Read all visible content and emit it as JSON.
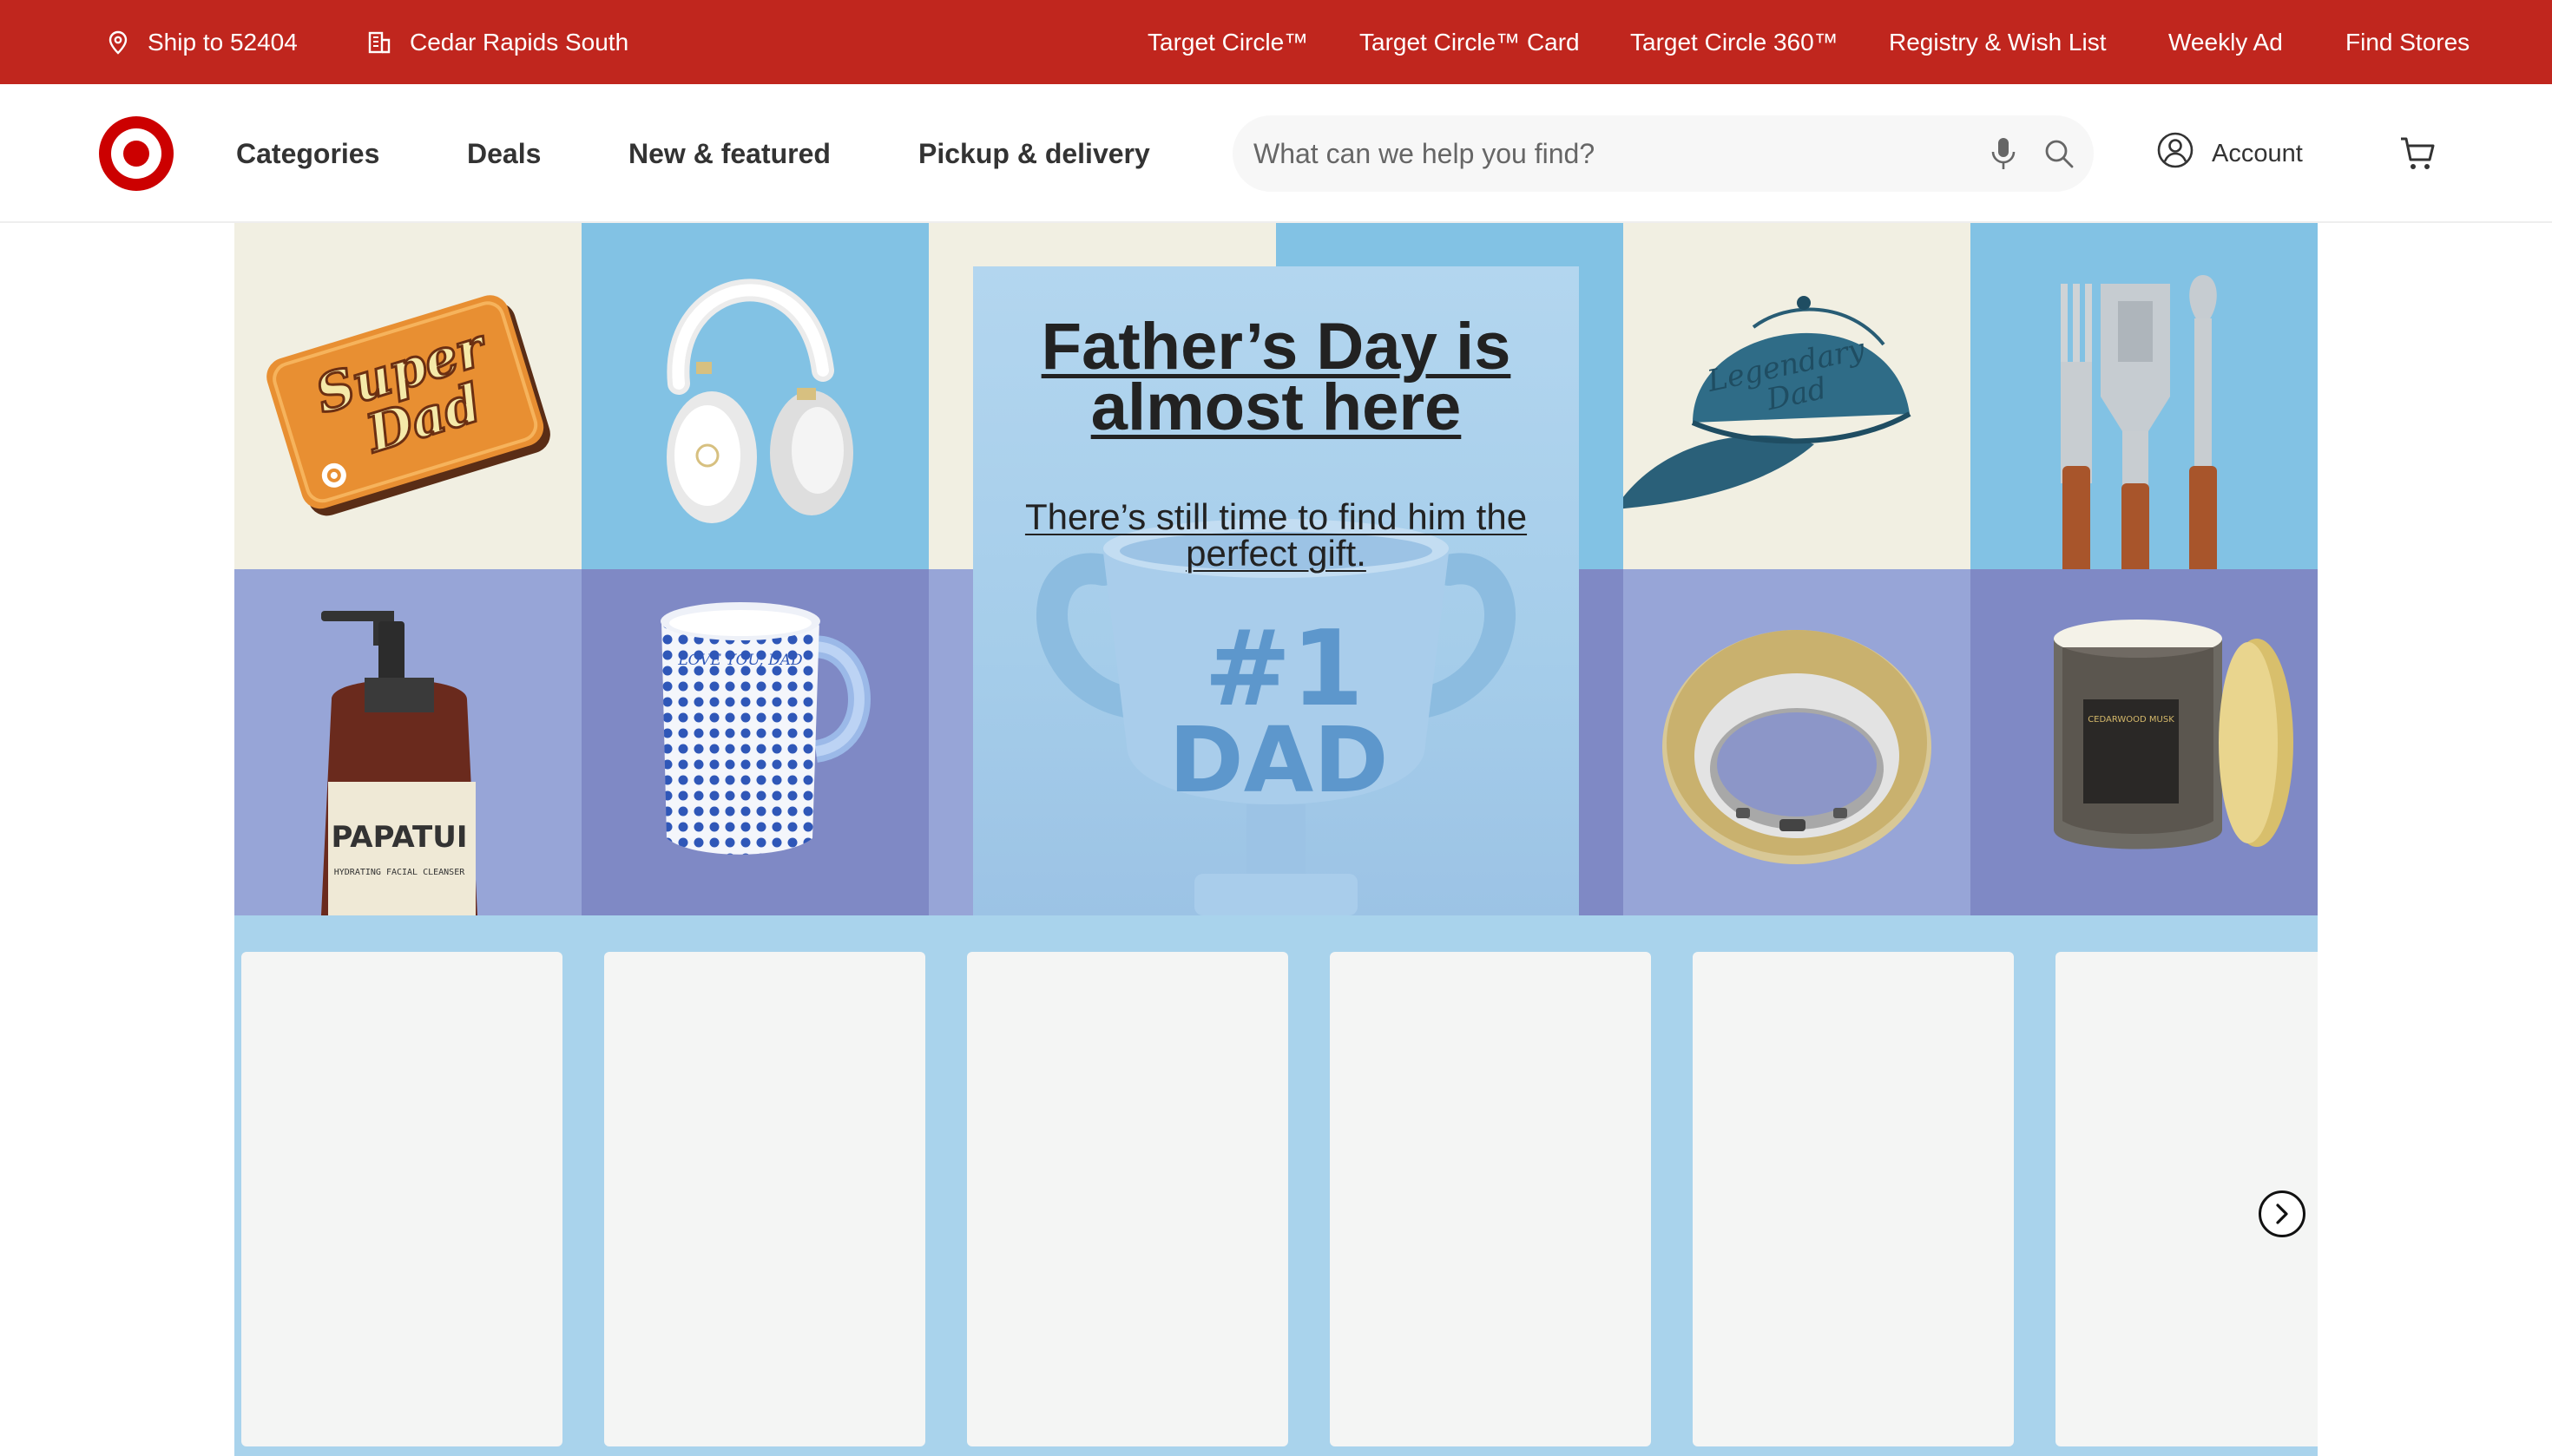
{
  "utility_bar": {
    "ship_to": "Ship to 52404",
    "store": "Cedar Rapids South",
    "links": [
      "Target Circle™",
      "Target Circle™ Card",
      "Target Circle 360™",
      "Registry & Wish List",
      "Weekly Ad",
      "Find Stores"
    ]
  },
  "header": {
    "nav": [
      "Categories",
      "Deals",
      "New & featured",
      "Pickup & delivery"
    ],
    "search_placeholder": "What can we help you find?",
    "account_label": "Account"
  },
  "hero": {
    "headline": "Father’s Day is almost here",
    "subline": "There’s still time to find him the perfect gift.",
    "gift_card_text": "Super Dad",
    "hat_text": "Legendary Dad",
    "mug_text": "LOVE YOU, DAD",
    "trophy_line1": "#1",
    "trophy_line2": "DAD",
    "bottle_brand": "PAPATUI",
    "bottle_sub": "HYDRATING FACIAL CLEANSER",
    "candle_label": "CEDARWOOD MUSK"
  },
  "colors": {
    "brand_red": "#c0261e",
    "rail_blue": "#a9d3ec"
  },
  "rail": {
    "card_count": 6
  }
}
